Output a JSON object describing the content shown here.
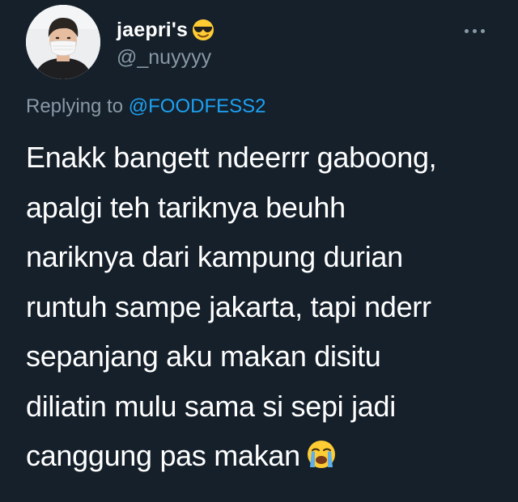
{
  "author": {
    "display_name": "jaepri's",
    "name_emoji": "smiling-face-with-sunglasses-icon",
    "handle": "@_nuyyyy"
  },
  "reply": {
    "prefix": "Replying to ",
    "target": "@FOODFESS2"
  },
  "tweet": {
    "lines": [
      "Enakk bangett ndeerrr gaboong,",
      "apalgi teh tariknya beuhh",
      "nariknya dari kampung durian",
      "runtuh sampe jakarta, tapi nderr",
      "sepanjang aku makan disitu",
      "diliatin mulu sama si sepi jadi",
      "canggung pas makan"
    ],
    "trailing_emoji": "loudly-crying-face-icon"
  },
  "colors": {
    "background": "#15202b",
    "text": "#ffffff",
    "secondary": "#8899a6",
    "link": "#1da1f2"
  }
}
